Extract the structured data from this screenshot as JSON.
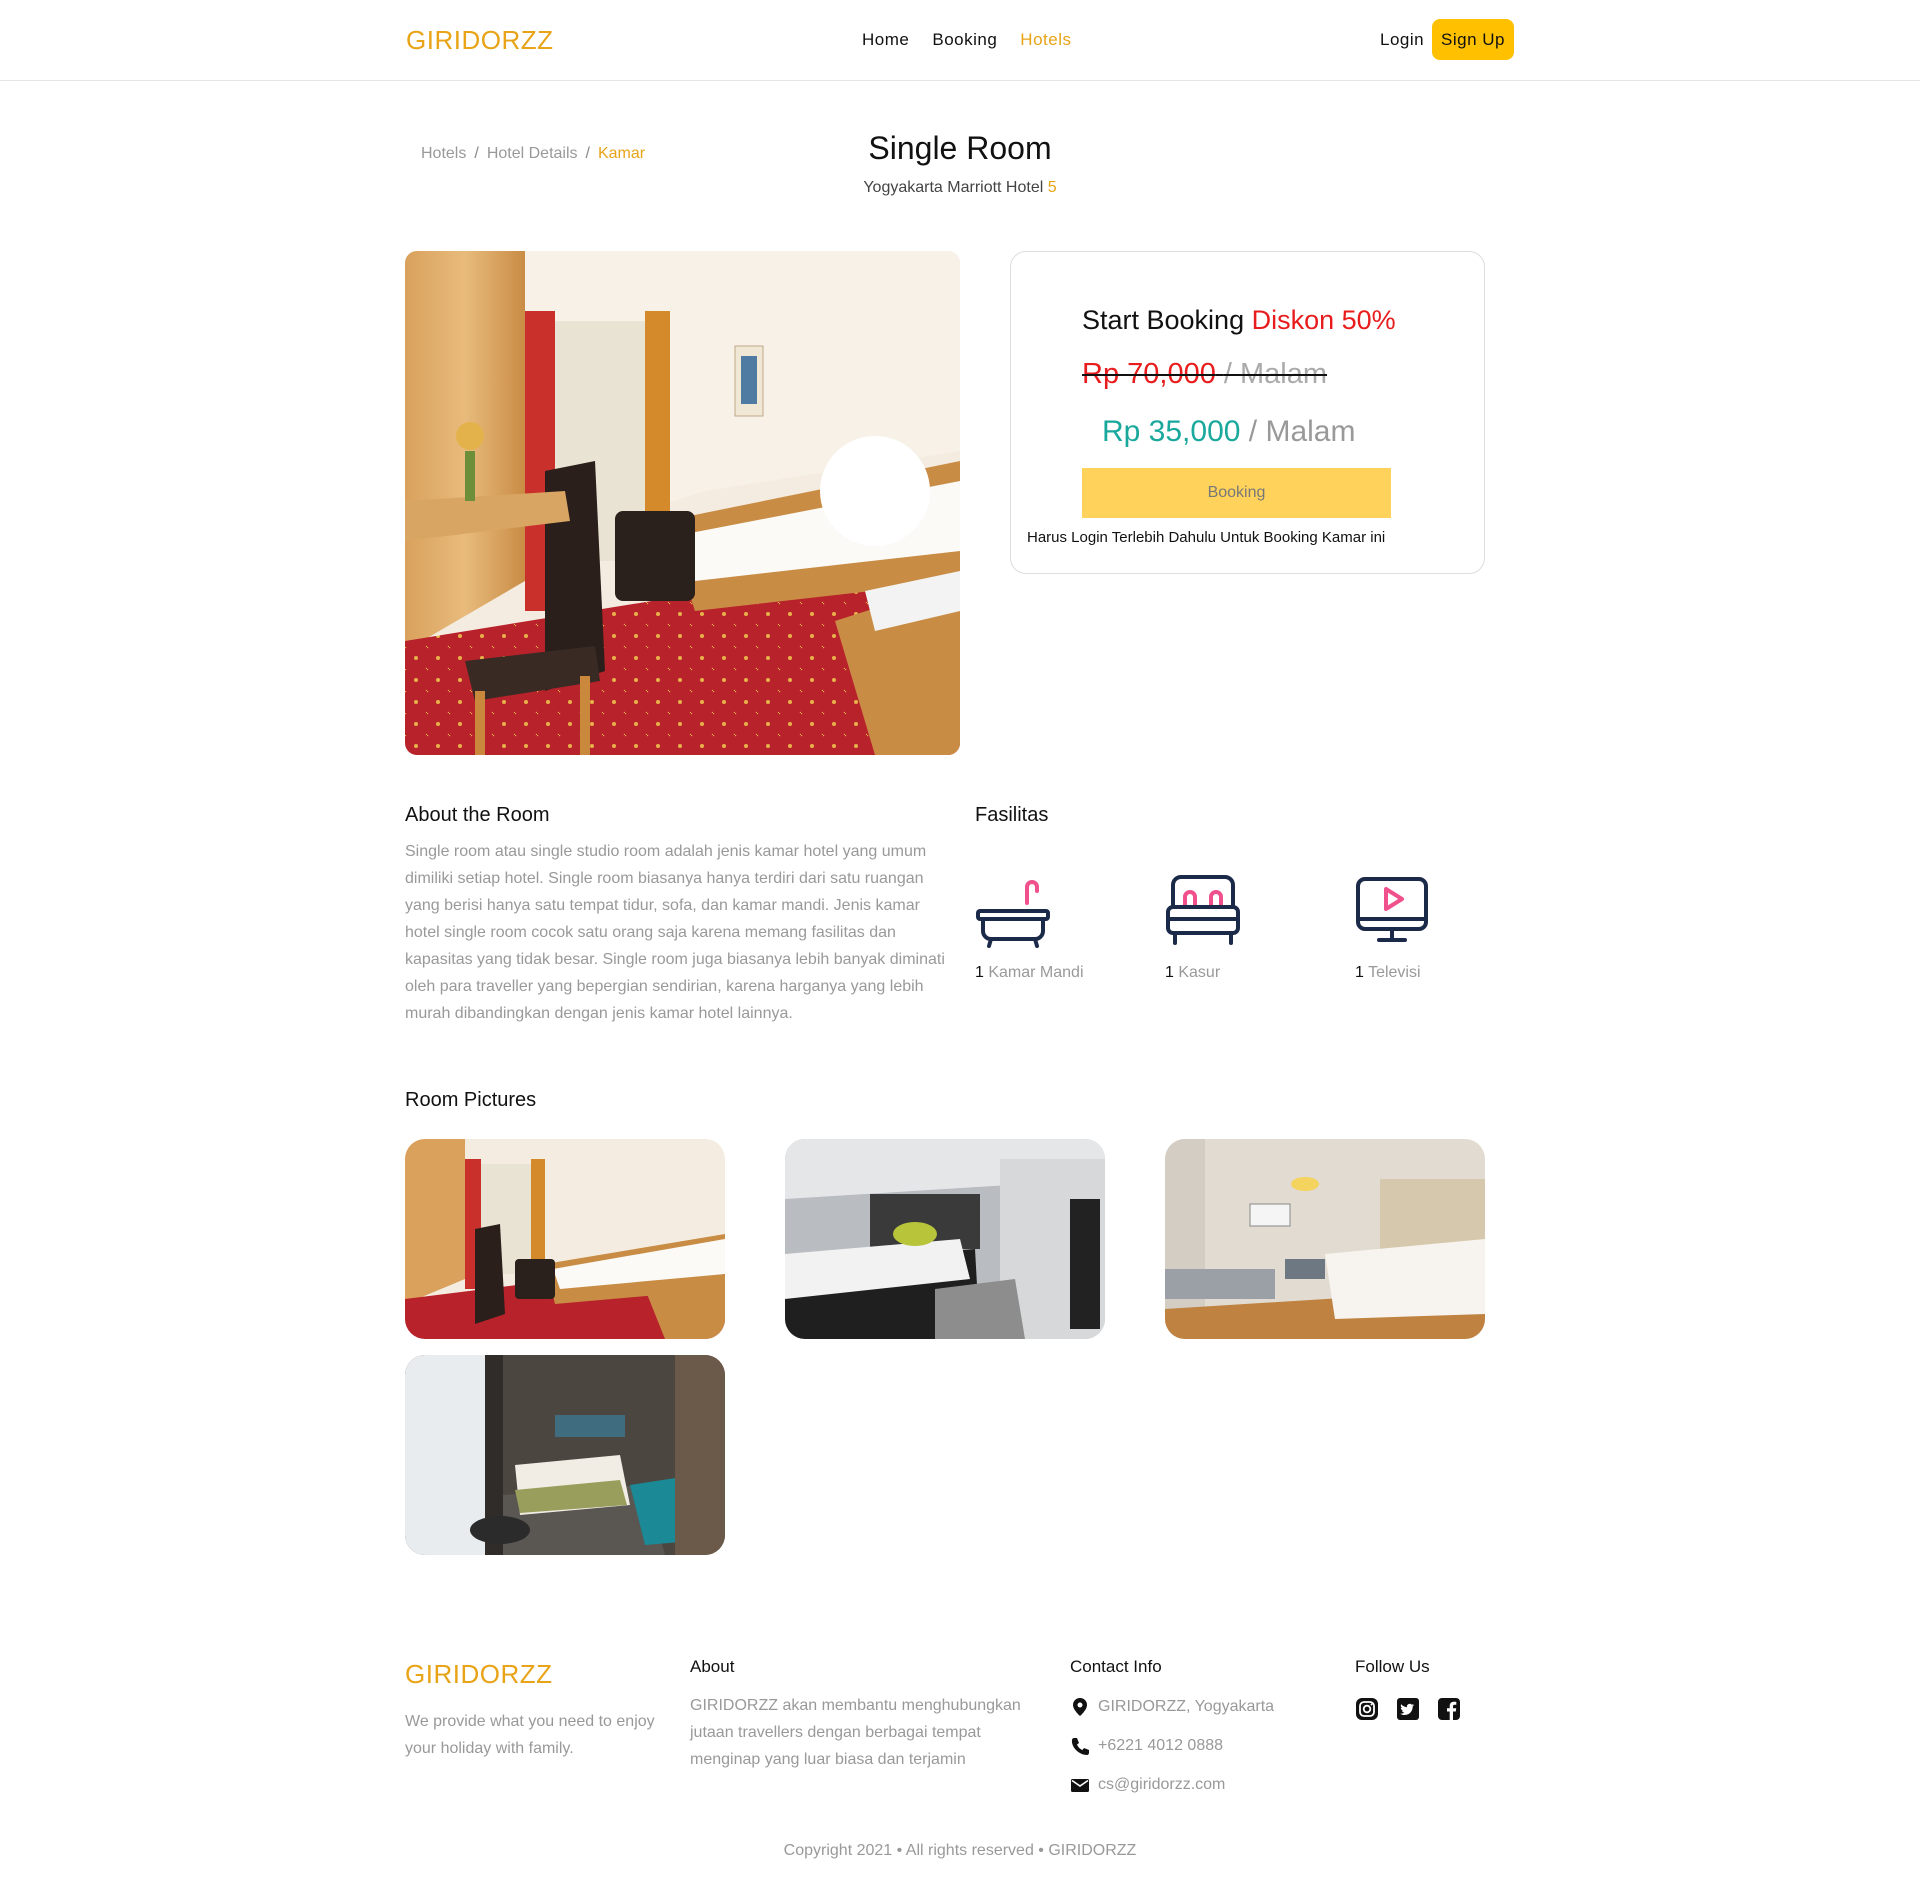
{
  "navbar": {
    "brand": "GIRIDORZZ",
    "links": [
      "Home",
      "Booking",
      "Hotels"
    ],
    "active_link": "Hotels",
    "login": "Login",
    "signup": "Sign Up"
  },
  "breadcrumb": [
    "Hotels",
    "Hotel Details",
    "Kamar"
  ],
  "header": {
    "title": "Single Room",
    "hotel_name": "Yogyakarta Marriott Hotel",
    "stars": "5"
  },
  "booking": {
    "title": "Start Booking",
    "discount": "Diskon 50%",
    "old_price": "Rp 70,000",
    "old_unit": "/ Malam",
    "new_price": "Rp 35,000",
    "new_unit": "/ Malam",
    "button": "Booking",
    "note": "Harus Login Terlebih Dahulu Untuk Booking Kamar ini"
  },
  "about": {
    "title": "About the Room",
    "text": "Single room atau single studio room adalah jenis kamar hotel yang umum dimiliki setiap hotel. Single room biasanya hanya terdiri dari satu ruangan yang berisi hanya satu tempat tidur, sofa, dan kamar mandi. Jenis kamar hotel single room cocok satu orang saja karena memang fasilitas dan kapasitas yang tidak besar. Single room juga biasanya lebih banyak diminati oleh para traveller yang bepergian sendirian, karena harganya yang lebih murah dibandingkan dengan jenis kamar hotel lainnya."
  },
  "facilities": {
    "title": "Fasilitas",
    "items": [
      {
        "count": "1",
        "label": "Kamar Mandi",
        "icon": "bathtub-icon"
      },
      {
        "count": "1",
        "label": "Kasur",
        "icon": "bed-icon"
      },
      {
        "count": "1",
        "label": "Televisi",
        "icon": "television-icon"
      }
    ]
  },
  "room_pictures": {
    "title": "Room Pictures",
    "count": 4
  },
  "footer": {
    "brand": "GIRIDORZZ",
    "tagline": "We provide what you need to enjoy your holiday with family.",
    "about_title": "About",
    "about_text": "GIRIDORZZ akan membantu menghubungkan jutaan travellers dengan berbagai tempat menginap yang luar biasa dan terjamin",
    "contact_title": "Contact Info",
    "address": "GIRIDORZZ, Yogyakarta",
    "phone": "+6221 4012 0888",
    "email": "cs@giridorzz.com",
    "follow_title": "Follow Us",
    "socials": [
      "instagram-icon",
      "twitter-icon",
      "facebook-icon"
    ],
    "copyright": "Copyright 2021 • All rights reserved • GIRIDORZZ"
  },
  "colors": {
    "accent": "#e8a317",
    "signup_bg": "#ffc000",
    "booking_btn": "#ffd35b",
    "discount_red": "#e81c1c",
    "price_teal": "#1aa89c",
    "icon_navy": "#1c2a4a",
    "icon_pink": "#f0508c"
  }
}
